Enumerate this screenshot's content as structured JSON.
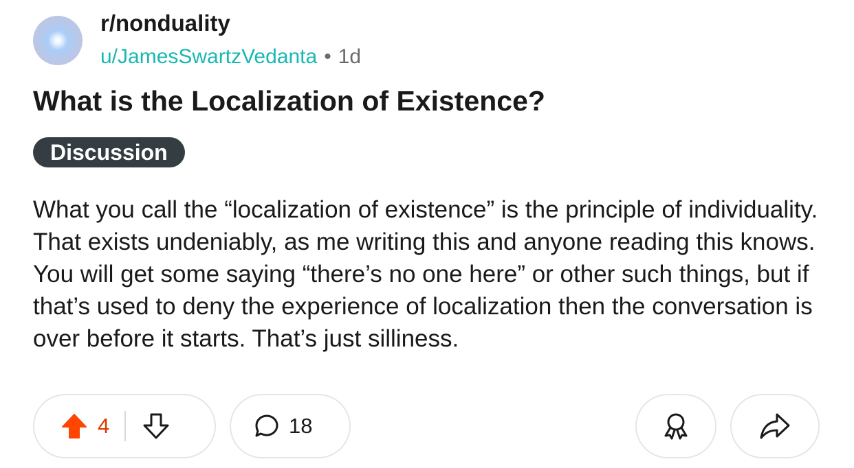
{
  "post": {
    "subreddit": "r/nonduality",
    "author": "u/JamesSwartzVedanta",
    "separator": "•",
    "age": "1d",
    "title": "What is the Localization of Existence?",
    "flair": "Discussion",
    "body": "What you call the “localization of existence” is the principle of individuality. That exists undeniably, as me writing this and anyone reading this knows. You will get some saying “there’s no one here” or other such things, but if that’s used to deny the experience of localization then the conversation is over before it starts. That’s just silliness."
  },
  "actions": {
    "score": "4",
    "comments": "18",
    "icons": [
      "upvote-icon",
      "downvote-icon",
      "comment-icon",
      "award-icon",
      "share-icon"
    ]
  },
  "colors": {
    "upvote_active": "#ff4500",
    "username": "#18b8b3",
    "flair_bg": "#333d42"
  }
}
